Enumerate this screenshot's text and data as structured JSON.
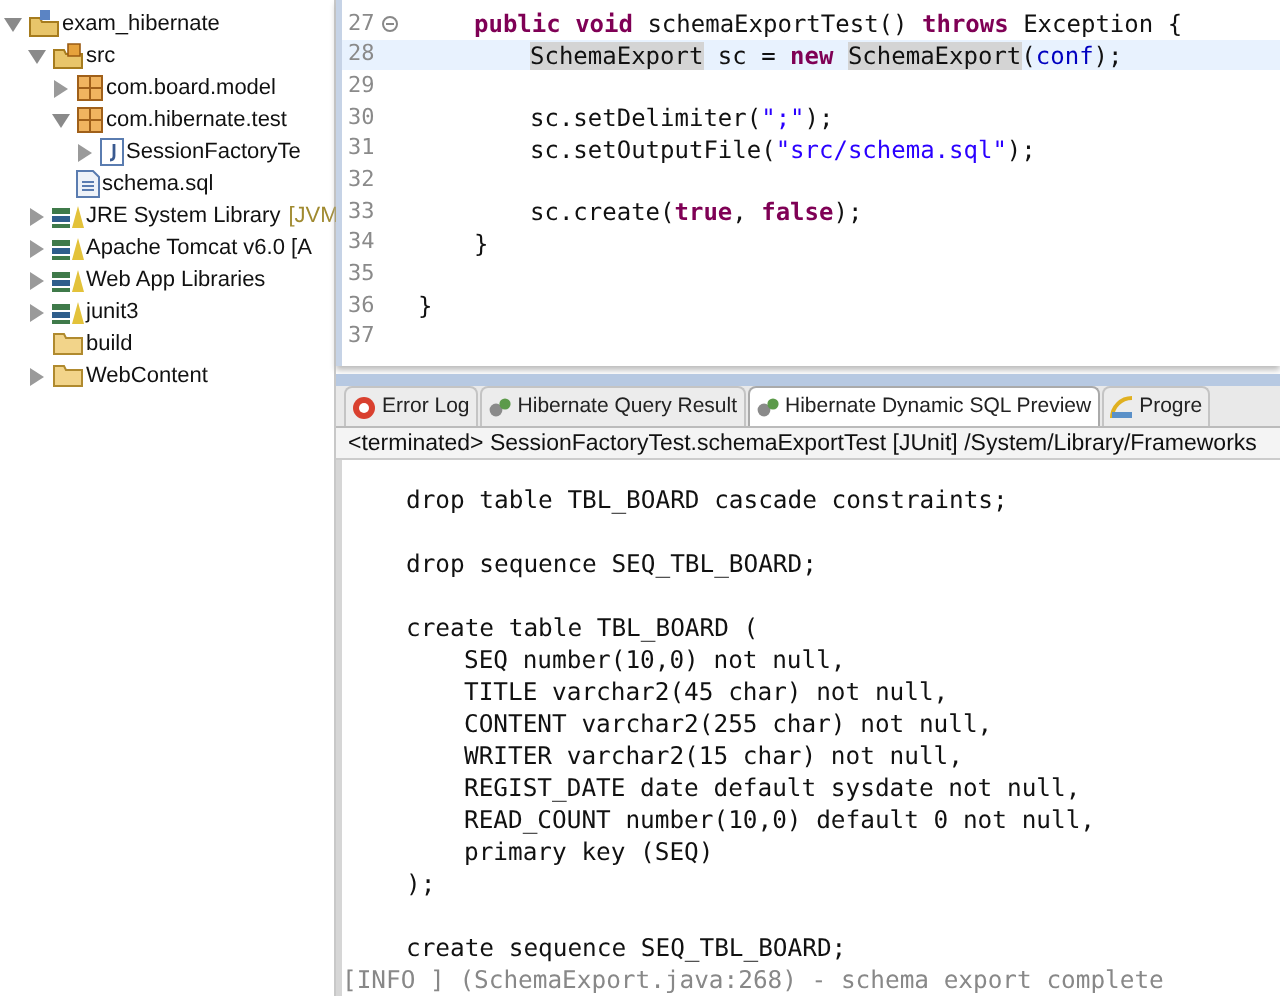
{
  "tree": [
    {
      "label": "exam_hibernate",
      "kind": "project",
      "expanded": true,
      "children": [
        {
          "label": "src",
          "kind": "source-folder",
          "expanded": true,
          "children": [
            {
              "label": "com.board.model",
              "kind": "package",
              "expanded": false
            },
            {
              "label": "com.hibernate.test",
              "kind": "package",
              "expanded": true,
              "children": [
                {
                  "label": "SessionFactoryTe",
                  "kind": "java",
                  "expanded": false
                }
              ]
            },
            {
              "label": "schema.sql",
              "kind": "file"
            }
          ]
        },
        {
          "label": "JRE System Library",
          "decoration": "[JVM",
          "kind": "library",
          "expanded": false
        },
        {
          "label": "Apache Tomcat v6.0 [A",
          "kind": "library",
          "expanded": false
        },
        {
          "label": "Web App Libraries",
          "kind": "library",
          "expanded": false
        },
        {
          "label": "junit3",
          "kind": "library",
          "expanded": false
        },
        {
          "label": "build",
          "kind": "folder"
        },
        {
          "label": "WebContent",
          "kind": "folder",
          "expanded": false
        }
      ]
    }
  ],
  "editor": {
    "lines": [
      {
        "number": "27",
        "fold": true,
        "current": false,
        "kind": "method",
        "tokens": [
          {
            "text": "public",
            "kind": "keyword"
          },
          {
            "text": " void",
            "kind": "keyword"
          },
          {
            "text": " schemaExportTest()",
            "kind": "plain"
          },
          {
            "text": " throws",
            "kind": "keyword"
          },
          {
            "text": " Exception {",
            "kind": "plain"
          }
        ]
      },
      {
        "number": "28",
        "fold": false,
        "current": true,
        "kind": "statement",
        "tokens": [
          {
            "text": "SchemaExport",
            "kind": "occurrence"
          },
          {
            "text": " sc =",
            "kind": "plain"
          },
          {
            "text": " new ",
            "kind": "keyword"
          },
          {
            "text": "SchemaExport",
            "kind": "occurrence"
          },
          {
            "text": "(",
            "kind": "plain"
          },
          {
            "text": "conf",
            "kind": "field"
          },
          {
            "text": ");",
            "kind": "plain"
          }
        ]
      },
      {
        "number": "29",
        "fold": false,
        "current": false
      },
      {
        "number": "30",
        "fold": false,
        "current": false,
        "kind": "statement",
        "tokens": [
          {
            "text": "sc.setDelimiter(",
            "kind": "plain"
          },
          {
            "text": "\";\"",
            "kind": "string"
          },
          {
            "text": ");",
            "kind": "plain"
          }
        ]
      },
      {
        "number": "31",
        "fold": false,
        "current": false,
        "kind": "statement",
        "tokens": [
          {
            "text": "sc.setOutputFile(",
            "kind": "plain"
          },
          {
            "text": "\"src/schema.sql\"",
            "kind": "string"
          },
          {
            "text": ");",
            "kind": "plain"
          }
        ]
      },
      {
        "number": "32",
        "fold": false,
        "current": false
      },
      {
        "number": "33",
        "fold": false,
        "current": false,
        "kind": "statement",
        "tokens": [
          {
            "text": "sc.create(",
            "kind": "plain"
          },
          {
            "text": "true",
            "kind": "keyword"
          },
          {
            "text": ", ",
            "kind": "plain"
          },
          {
            "text": "false",
            "kind": "keyword"
          },
          {
            "text": ");",
            "kind": "plain"
          }
        ]
      },
      {
        "number": "34",
        "fold": false,
        "current": false,
        "kind": "method",
        "tokens": [
          {
            "text": "}",
            "kind": "plain"
          }
        ]
      },
      {
        "number": "35",
        "fold": false,
        "current": false
      },
      {
        "number": "36",
        "fold": false,
        "current": false,
        "kind": "class",
        "tokens": [
          {
            "text": "}",
            "kind": "plain"
          }
        ]
      },
      {
        "number": "37",
        "fold": false,
        "current": false
      }
    ]
  },
  "tabs": [
    {
      "label": "Error Log",
      "kind": "error",
      "selected": false
    },
    {
      "label": "Hibernate Query Result",
      "kind": "hibernate",
      "selected": false
    },
    {
      "label": "Hibernate Dynamic SQL Preview",
      "kind": "hibernate",
      "selected": true
    },
    {
      "label": "Progre",
      "kind": "progress",
      "selected": false
    }
  ],
  "console": {
    "status": "<terminated> SessionFactoryTest.schemaExportTest [JUnit] /System/Library/Frameworks",
    "statements": [
      {
        "text": "drop table TBL_BOARD cascade constraints;"
      },
      {
        "text": "drop sequence SEQ_TBL_BOARD;"
      },
      {
        "text": "create table TBL_BOARD (",
        "children": [
          "SEQ number(10,0) not null,",
          "TITLE varchar2(45 char) not null,",
          "CONTENT varchar2(255 char) not null,",
          "WRITER varchar2(15 char) not null,",
          "REGIST_DATE date default sysdate not null,",
          "READ_COUNT number(10,0) default 0 not null,",
          "primary key (SEQ)"
        ],
        "closing": ");"
      },
      {
        "text": "create sequence SEQ_TBL_BOARD;"
      }
    ],
    "log": "[INFO ] (SchemaExport.java:268) - schema export complete"
  }
}
